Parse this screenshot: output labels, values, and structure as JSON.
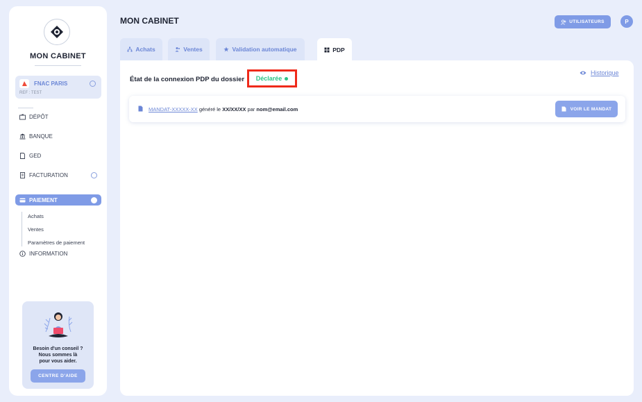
{
  "app": {
    "brand": "MON CABINET"
  },
  "client": {
    "name": "FNAC PARIS",
    "ref": "REF : TEST"
  },
  "sidebar": {
    "items": [
      {
        "label": "DÉPÔT",
        "icon": "folder-icon"
      },
      {
        "label": "BANQUE",
        "icon": "bank-icon"
      },
      {
        "label": "GED",
        "icon": "document-icon"
      },
      {
        "label": "FACTURATION",
        "icon": "invoice-icon"
      },
      {
        "label": "PAIEMENT",
        "icon": "card-icon",
        "active": true
      },
      {
        "label": "INFORMATION",
        "icon": "info-icon"
      }
    ],
    "subitems": [
      "Achats",
      "Ventes",
      "Paramètres de paiement"
    ]
  },
  "help": {
    "line1": "Besoin d'un conseil ?",
    "line2": "Nous sommes là",
    "line3": "pour vous aider.",
    "button": "CENTRE D'AIDE"
  },
  "header": {
    "title": "MON CABINET",
    "users_button": "UTILISATEURS",
    "avatar_initial": "P"
  },
  "tabs": [
    {
      "label": "Achats",
      "icon": "network-icon"
    },
    {
      "label": "Ventes",
      "icon": "users-icon"
    },
    {
      "label": "Validation automatique",
      "icon": "star-icon"
    },
    {
      "label": "PDP",
      "icon": "grid-icon",
      "active": true
    }
  ],
  "main": {
    "connection_label": "État de la connexion PDP du dossier",
    "status": "Déclarée",
    "history_link": "Historique",
    "mandate": {
      "id": "MANDAT-XXXXX-XX",
      "text1": "généré le",
      "date": "XX/XX/XX",
      "text2": "par",
      "email": "nom@email.com",
      "button": "VOIR LE MANDAT"
    }
  },
  "colors": {
    "accent": "#7f9be6",
    "status_ok": "#2cc487",
    "highlight": "#ef2a1a",
    "background": "#e9eefb"
  }
}
